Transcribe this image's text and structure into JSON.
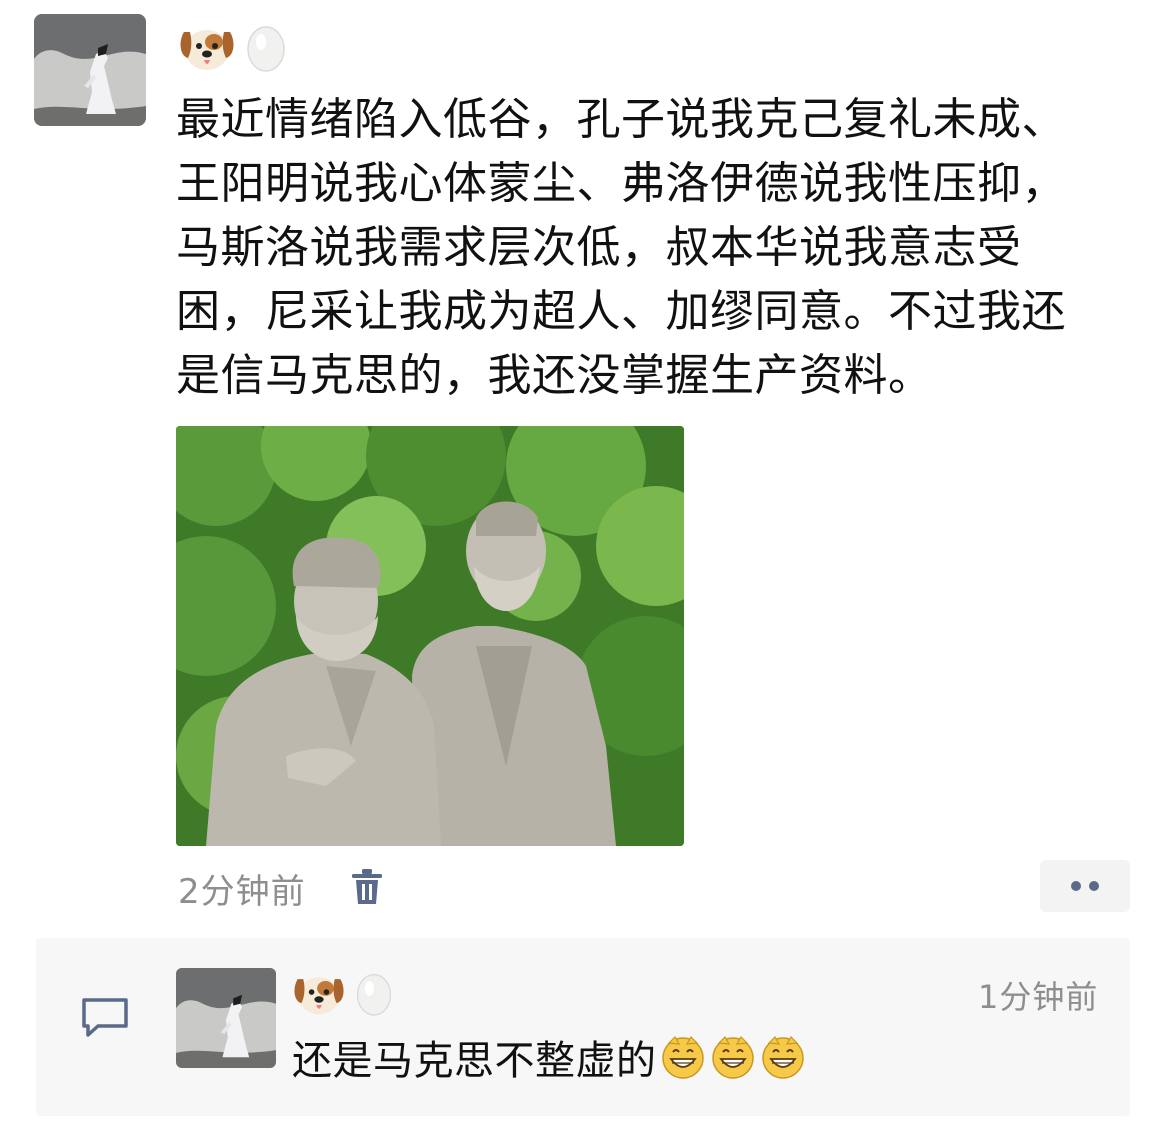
{
  "post": {
    "avatar_icon": "ink-painting-figure-avatar",
    "name_icons": [
      "dog-face-icon",
      "egg-icon"
    ],
    "text": "最近情绪陷入低谷，孔子说我克己复礼未成、\n王阳明说我心体蒙尘、弗洛伊德说我性压抑，\n马斯洛说我需求层次低，叔本华说我意志受\n困，尼采让我成为超人、加缪同意。不过我还\n是信马克思的，我还没掌握生产资料。",
    "image_icon": "marx-engels-statue-photo",
    "time": "2分钟前",
    "delete_icon": "trash-icon",
    "more_icon": "more-dots-icon"
  },
  "comment": {
    "icon": "comment-bubble-icon",
    "avatar_icon": "ink-painting-figure-avatar",
    "name_icons": [
      "dog-face-icon",
      "egg-icon"
    ],
    "time": "1分钟前",
    "text": "还是马克思不整虚的",
    "emoji_icons": [
      "grinning-face-icon",
      "grinning-face-icon",
      "grinning-face-icon"
    ]
  },
  "colors": {
    "text": "#111111",
    "meta": "#8e8e8e",
    "link_blue": "#5a6a8a",
    "comment_bg": "#f7f7f7"
  }
}
